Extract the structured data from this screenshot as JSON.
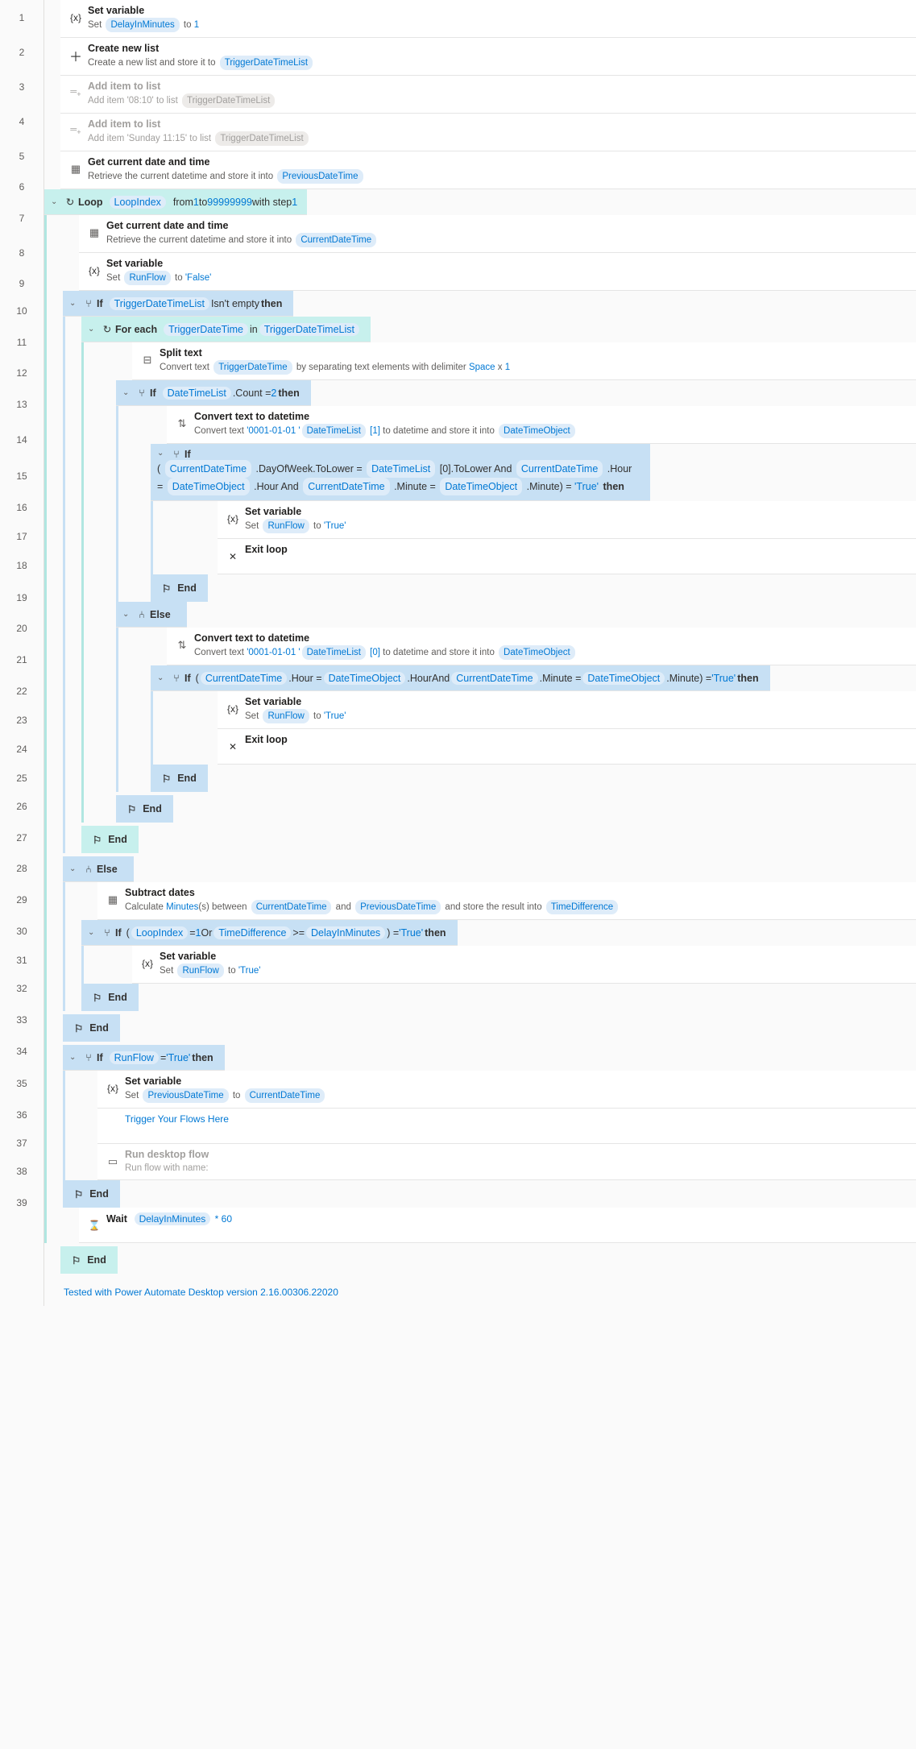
{
  "lines": [
    "1",
    "2",
    "3",
    "4",
    "5",
    "6",
    "7",
    "8",
    "9",
    "10",
    "11",
    "12",
    "13",
    "14",
    "15",
    "16",
    "17",
    "18",
    "19",
    "20",
    "21",
    "22",
    "23",
    "24",
    "25",
    "26",
    "27",
    "28",
    "29",
    "30",
    "31",
    "32",
    "33",
    "34",
    "35",
    "36",
    "37",
    "38",
    "39"
  ],
  "s1": {
    "title": "Set variable",
    "pre": "Set ",
    "var": "DelayInMinutes",
    "mid": " to ",
    "val": "1"
  },
  "s2": {
    "title": "Create new list",
    "pre": "Create a new list and store it to ",
    "var": "TriggerDateTimeList"
  },
  "s3": {
    "title": "Add item to list",
    "pre": "Add item ",
    "v1": "'08:10'",
    "mid": " to list ",
    "var": "TriggerDateTimeList"
  },
  "s4": {
    "title": "Add item to list",
    "pre": "Add item ",
    "v1": "'Sunday 11:15'",
    "mid": " to list ",
    "var": "TriggerDateTimeList"
  },
  "s5": {
    "title": "Get current date and time",
    "pre": "Retrieve the current datetime and store it into ",
    "var": "PreviousDateTime"
  },
  "s6": {
    "lbl": "Loop",
    "var": "LoopIndex",
    "t1": "from ",
    "v1": "1",
    "t2": " to ",
    "v2": "99999999",
    "t3": " with step ",
    "v3": "1"
  },
  "s7": {
    "title": "Get current date and time",
    "pre": "Retrieve the current datetime and store it into ",
    "var": "CurrentDateTime"
  },
  "s8": {
    "title": "Set variable",
    "pre": "Set ",
    "var": "RunFlow",
    "mid": " to ",
    "val": "'False'"
  },
  "s9": {
    "lbl": "If",
    "var": "TriggerDateTimeList",
    "t1": " Isn't empty ",
    "then": "then"
  },
  "s10": {
    "lbl": "For each",
    "var1": "TriggerDateTime",
    "in": " in ",
    "var2": "TriggerDateTimeList"
  },
  "s11": {
    "title": "Split text",
    "pre": "Convert text ",
    "var": "TriggerDateTime",
    "mid": " by separating text elements with delimiter ",
    "v1": "Space",
    "x": " x ",
    "v2": "1"
  },
  "s12": {
    "lbl": "If",
    "var": "DateTimeList",
    "p": " .Count = ",
    "v": "2",
    "then": " then"
  },
  "s13": {
    "title": "Convert text to datetime",
    "pre": "Convert text ",
    "v1": "'0001-01-01 '",
    "var": "DateTimeList",
    "idx": " [1]",
    "mid": " to datetime and store it into ",
    "var2": "DateTimeObject"
  },
  "s14": {
    "lbl": "If",
    "t1": " ( ",
    "v1": "CurrentDateTime",
    "p1": " .DayOfWeek.ToLower = ",
    "v2": "DateTimeList",
    "p2": " [0].ToLower ",
    "and1": "And",
    "sp": "  ",
    "v3": "CurrentDateTime",
    "p3": " .Hour = ",
    "v4": "DateTimeObject",
    "p4": " .Hour ",
    "and2": "And",
    "br": " ",
    "v5": "CurrentDateTime",
    "p5": " .Minute = ",
    "v6": "DateTimeObject",
    "p6": " .Minute) = ",
    "tv": "'True'",
    "then": " then"
  },
  "s15": {
    "title": "Set variable",
    "pre": "Set ",
    "var": "RunFlow",
    "mid": " to ",
    "val": "'True'"
  },
  "s16": {
    "title": "Exit loop"
  },
  "s17": {
    "lbl": "End"
  },
  "s18": {
    "lbl": "Else"
  },
  "s19": {
    "title": "Convert text to datetime",
    "pre": "Convert text ",
    "v1": "'0001-01-01 '",
    "var": "DateTimeList",
    "idx": " [0]",
    "mid": " to datetime and store it into ",
    "var2": "DateTimeObject"
  },
  "s20": {
    "lbl": "If",
    "t1": " ( ",
    "v1": "CurrentDateTime",
    "p1": " .Hour = ",
    "v2": "DateTimeObject",
    "p2": " .Hour ",
    "and": "And",
    "sp": "  ",
    "v3": "CurrentDateTime",
    "p3": " .Minute = ",
    "v4": "DateTimeObject",
    "p4": " .Minute) = ",
    "tv": "'True'",
    "then": " then"
  },
  "s21": {
    "title": "Set variable",
    "pre": "Set ",
    "var": "RunFlow",
    "mid": " to ",
    "val": "'True'"
  },
  "s22": {
    "title": "Exit loop"
  },
  "s23": {
    "lbl": "End"
  },
  "s24": {
    "lbl": "End"
  },
  "s25": {
    "lbl": "End"
  },
  "s26": {
    "lbl": "Else"
  },
  "s27": {
    "title": "Subtract dates",
    "t1": "Calculate ",
    "v1": "Minutes",
    "t2": "(s) between ",
    "var1": "CurrentDateTime",
    "t3": " and ",
    "var2": "PreviousDateTime",
    "t4": " and store the result into ",
    "var3": "TimeDifference"
  },
  "s28": {
    "lbl": "If",
    "t1": " ( ",
    "v1": "LoopIndex",
    "p1": " = ",
    "n1": "1",
    "or": " Or ",
    "v2": "TimeDifference",
    "p2": " >= ",
    "v3": "DelayInMinutes",
    "p3": " ) = ",
    "tv": "'True'",
    "then": " then"
  },
  "s29": {
    "title": "Set variable",
    "pre": "Set ",
    "var": "RunFlow",
    "mid": " to ",
    "val": "'True'"
  },
  "s30": {
    "lbl": "End"
  },
  "s31": {
    "lbl": "End"
  },
  "s32": {
    "lbl": "If",
    "v1": "RunFlow",
    "p1": " = ",
    "tv": "'True'",
    "then": " then"
  },
  "s33": {
    "title": "Set variable",
    "pre": "Set ",
    "var1": "PreviousDateTime",
    "mid": " to ",
    "var2": "CurrentDateTime"
  },
  "s34": {
    "text": "Trigger Your Flows Here"
  },
  "s35": {
    "title": "Run desktop flow",
    "desc": "Run flow with name:"
  },
  "s36": {
    "lbl": "End"
  },
  "s37": {
    "title": "Wait",
    "var": "DelayInMinutes",
    "v": " * 60"
  },
  "s38": {
    "lbl": "End"
  },
  "footer": "Tested with Power Automate Desktop version 2.16.00306.22020"
}
